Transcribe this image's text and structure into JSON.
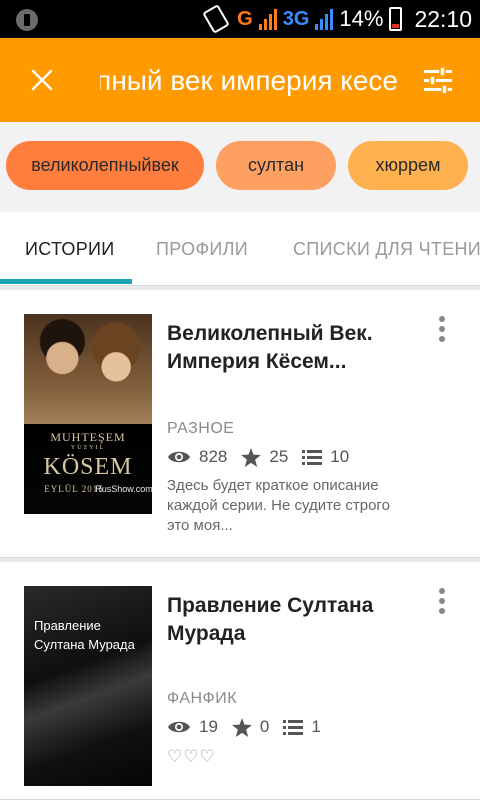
{
  "status_bar": {
    "network_1": "G",
    "network_2": "3G",
    "battery_percent": "14%",
    "time": "22:10",
    "icons": [
      "notification-icon",
      "phone-rotate-icon",
      "signal-icon",
      "battery-icon"
    ]
  },
  "app_bar": {
    "search_query": "Великолепный век империя кесе",
    "close_icon": "close-icon",
    "filter_icon": "filter-icon",
    "background_color": "#ff9a00"
  },
  "tags": [
    {
      "label": "великолепныйвек",
      "color": "#ff7e3e"
    },
    {
      "label": "султан",
      "color": "#ffa063"
    },
    {
      "label": "хюррем",
      "color": "#ffb04f"
    }
  ],
  "tabs": [
    {
      "label": "ИСТОРИИ",
      "active": true
    },
    {
      "label": "ПРОФИЛИ",
      "active": false
    },
    {
      "label": "СПИСКИ ДЛЯ ЧТЕНИЯ",
      "active": false
    }
  ],
  "accent_color": "#1aa3b3",
  "stories": [
    {
      "title": "Великолепный Век. Империя Кёсем...",
      "category": "РАЗНОЕ",
      "views": "828",
      "votes": "25",
      "parts": "10",
      "description": "Здесь будет краткое описание каждой серии. Не судите строго  это моя...",
      "cover": {
        "line1": "MUHTEŞEM",
        "line2": "YÜZYIL",
        "line3": "KÖSEM",
        "line4": "EYLÜL 2015",
        "line5": "RusShow.com"
      }
    },
    {
      "title": "Правление Султана Мурада",
      "category": "ФАНФИК",
      "views": "19",
      "votes": "0",
      "parts": "1",
      "hearts": "♡♡♡",
      "cover": {
        "text": "Правление Султана Мурада"
      }
    }
  ]
}
